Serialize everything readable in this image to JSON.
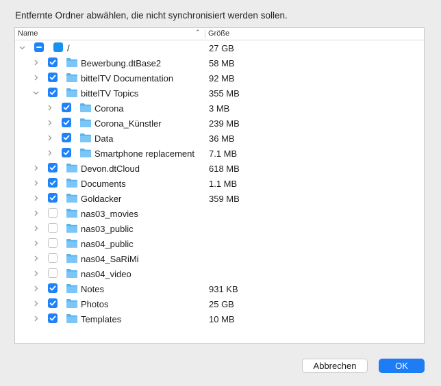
{
  "dialog": {
    "heading": "Entfernte Ordner abwählen, die nicht synchronisiert werden sollen.",
    "columns": {
      "name": "Name",
      "size": "Größe"
    },
    "buttons": {
      "cancel": "Abbrechen",
      "ok": "OK"
    },
    "accent_color": "#1e82fa"
  },
  "rows": [
    {
      "label": "/",
      "size": "27 GB",
      "depth": 0,
      "expanded": true,
      "state": "mixed",
      "icon": "disk-icon"
    },
    {
      "label": "Bewerbung.dtBase2",
      "size": "58 MB",
      "depth": 1,
      "expanded": false,
      "state": "on",
      "icon": "folder-icon"
    },
    {
      "label": "bittelTV Documentation",
      "size": "92 MB",
      "depth": 1,
      "expanded": false,
      "state": "on",
      "icon": "folder-icon"
    },
    {
      "label": "bittelTV Topics",
      "size": "355 MB",
      "depth": 1,
      "expanded": true,
      "state": "on",
      "icon": "folder-icon"
    },
    {
      "label": "Corona",
      "size": "3 MB",
      "depth": 2,
      "expanded": false,
      "state": "on",
      "icon": "folder-icon"
    },
    {
      "label": "Corona_Künstler",
      "size": "239 MB",
      "depth": 2,
      "expanded": false,
      "state": "on",
      "icon": "folder-icon"
    },
    {
      "label": "Data",
      "size": "36 MB",
      "depth": 2,
      "expanded": false,
      "state": "on",
      "icon": "folder-icon"
    },
    {
      "label": "Smartphone replacement",
      "size": "7.1 MB",
      "depth": 2,
      "expanded": false,
      "state": "on",
      "icon": "folder-icon"
    },
    {
      "label": "Devon.dtCloud",
      "size": "618 MB",
      "depth": 1,
      "expanded": false,
      "state": "on",
      "icon": "folder-icon"
    },
    {
      "label": "Documents",
      "size": "1.1 MB",
      "depth": 1,
      "expanded": false,
      "state": "on",
      "icon": "folder-icon"
    },
    {
      "label": "Goldacker",
      "size": "359 MB",
      "depth": 1,
      "expanded": false,
      "state": "on",
      "icon": "folder-icon"
    },
    {
      "label": "nas03_movies",
      "size": "",
      "depth": 1,
      "expanded": false,
      "state": "off",
      "icon": "folder-icon"
    },
    {
      "label": "nas03_public",
      "size": "",
      "depth": 1,
      "expanded": false,
      "state": "off",
      "icon": "folder-icon"
    },
    {
      "label": "nas04_public",
      "size": "",
      "depth": 1,
      "expanded": false,
      "state": "off",
      "icon": "folder-icon"
    },
    {
      "label": "nas04_SaRiMi",
      "size": "",
      "depth": 1,
      "expanded": false,
      "state": "off",
      "icon": "folder-icon"
    },
    {
      "label": "nas04_video",
      "size": "",
      "depth": 1,
      "expanded": false,
      "state": "off",
      "icon": "folder-icon"
    },
    {
      "label": "Notes",
      "size": "931 KB",
      "depth": 1,
      "expanded": false,
      "state": "on",
      "icon": "folder-icon"
    },
    {
      "label": "Photos",
      "size": "25 GB",
      "depth": 1,
      "expanded": false,
      "state": "on",
      "icon": "folder-icon"
    },
    {
      "label": "Templates",
      "size": "10 MB",
      "depth": 1,
      "expanded": false,
      "state": "on",
      "icon": "folder-icon"
    }
  ]
}
